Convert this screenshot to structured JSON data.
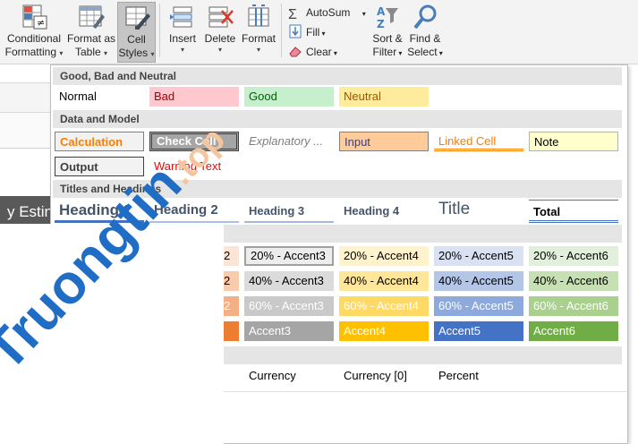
{
  "ribbon": {
    "conditional_formatting": [
      "Conditional",
      "Formatting"
    ],
    "format_as_table": [
      "Format as",
      "Table"
    ],
    "cell_styles": [
      "Cell",
      "Styles"
    ],
    "insert": "Insert",
    "delete": "Delete",
    "format": "Format",
    "autosum": "AutoSum",
    "fill": "Fill",
    "clear": "Clear",
    "sort_filter": [
      "Sort &",
      "Filter"
    ],
    "find_select": [
      "Find &",
      "Select"
    ]
  },
  "sheet": {
    "partial_text": "y Estin"
  },
  "gallery": {
    "sections": {
      "good_bad": "Good, Bad and Neutral",
      "data_model": "Data and Model",
      "titles": "Titles and Headings"
    },
    "good_bad": [
      "Normal",
      "Bad",
      "Good",
      "Neutral"
    ],
    "data_model_row1": [
      "Calculation",
      "Check Cell",
      "Explanatory ...",
      "Input",
      "Linked Cell",
      "Note"
    ],
    "data_model_row2": [
      "Output",
      "Warning Text"
    ],
    "titles": [
      "Heading 1",
      "Heading 2",
      "Heading 3",
      "Heading 4",
      "Title",
      "Total"
    ],
    "partial_left": [
      "2",
      "2",
      "2"
    ],
    "accent_20": [
      "20% - Accent3",
      "20% - Accent4",
      "20% - Accent5",
      "20% - Accent6"
    ],
    "accent_40": [
      "40% - Accent3",
      "40% - Accent4",
      "40% - Accent5",
      "40% - Accent6"
    ],
    "accent_60": [
      "60% - Accent3",
      "60% - Accent4",
      "60% - Accent5",
      "60% - Accent6"
    ],
    "accent_full": [
      "Accent3",
      "Accent4",
      "Accent5",
      "Accent6"
    ],
    "number_format": [
      "Currency",
      "Currency [0]",
      "Percent"
    ]
  },
  "watermark": {
    "main": "Truongtin",
    "suffix": ".top"
  },
  "colors": {
    "bad_bg": "#ffc7ce",
    "bad_fg": "#9c0006",
    "good_bg": "#c6efce",
    "good_fg": "#006100",
    "neutral_bg": "#ffeb9c",
    "neutral_fg": "#9c5700",
    "accent3": "#a5a5a5",
    "accent4": "#ffc000",
    "accent5": "#4472c4",
    "accent6": "#70ad47"
  }
}
